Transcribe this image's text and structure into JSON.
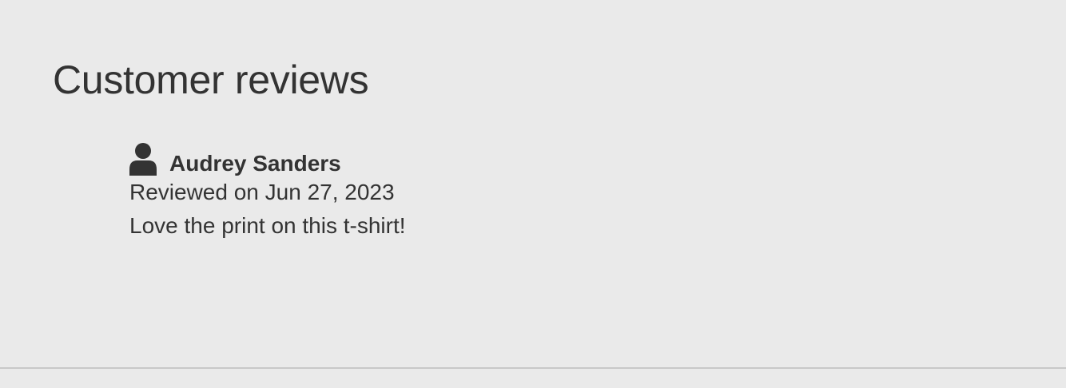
{
  "reviews": {
    "title": "Customer reviews",
    "items": [
      {
        "icon": "user-icon",
        "name": "Audrey Sanders",
        "date": "Reviewed on Jun 27, 2023",
        "text": "Love the print on this t-shirt!"
      }
    ]
  },
  "colors": {
    "background": "#eaeaea",
    "text": "#333333",
    "divider": "#c8c8c8"
  }
}
